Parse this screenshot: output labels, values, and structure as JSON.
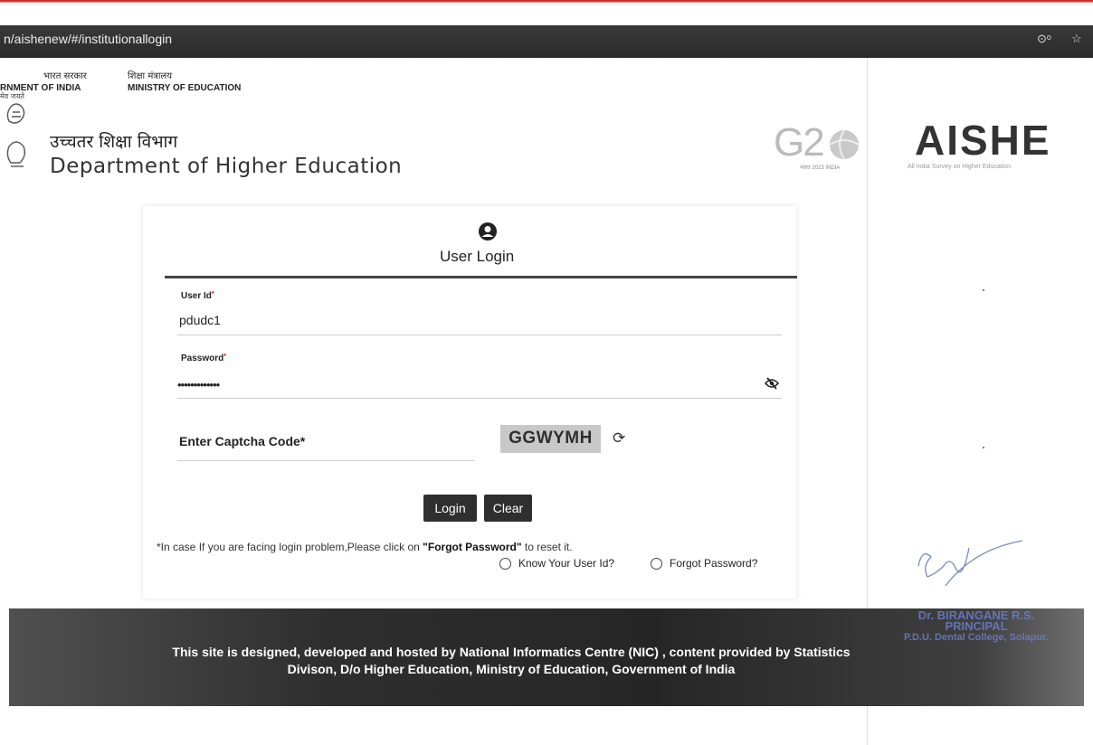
{
  "browser": {
    "url": "n/aishenew/#/institutionallogin"
  },
  "header": {
    "gov_hi": "भारत सरकार",
    "gov_en": "RNMENT OF INDIA",
    "ministry_hi": "शिक्षा मंत्रालय",
    "ministry_en": "MINISTRY OF EDUCATION",
    "emblem_caption": "मेव जयते",
    "dept_hi": "उच्चतर शिक्षा विभाग",
    "dept_en": "Department of Higher Education",
    "g20_logo": "G2",
    "g20_sub": "भारत 2023 INDIA",
    "aishe_logo": "AISHE",
    "aishe_sub": "All India Survey on Higher Education"
  },
  "login": {
    "title": "User Login",
    "user_id_label": "User Id",
    "user_id_value": "pdudc1",
    "password_label": "Password",
    "password_value": "•••••••••••••",
    "captcha_label": "Enter Captcha Code*",
    "captcha_code": "GGWYMH",
    "login_button": "Login",
    "clear_button": "Clear",
    "note_prefix": "*In case If you are facing login problem,Please click on ",
    "note_bold": "\"Forgot Password\"",
    "note_suffix": " to reset it.",
    "option_user_id": "Know Your User Id?",
    "option_forgot": "Forgot Password?"
  },
  "footer": {
    "text": "This site is designed, developed and hosted by National Informatics Centre (NIC) , content provided by Statistics Divison, D/o Higher Education, Ministry of Education, Government of India"
  },
  "stamp": {
    "line1": "Dr. BIRANGANE R.S.",
    "line2": "PRINCIPAL",
    "line3": "P.D.U. Dental College, Solapur."
  },
  "icons": {
    "user": "user-circle-icon",
    "eye": "eye-slash-icon",
    "refresh": "refresh-icon",
    "key": "key-icon",
    "star": "star-icon"
  }
}
